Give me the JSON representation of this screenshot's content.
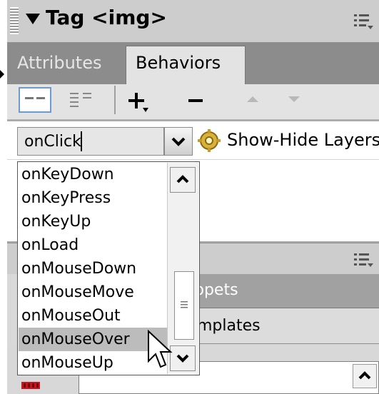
{
  "panel": {
    "title": "Tag <img>",
    "tabs": [
      {
        "label": "Attributes",
        "active": false
      },
      {
        "label": "Behaviors",
        "active": true
      }
    ]
  },
  "toolbar": {
    "show_set_events_icon": "list-view-icon",
    "show_all_events_icon": "list-all-icon",
    "add_icon": "plus-icon",
    "remove_icon": "minus-icon",
    "move_up_icon": "up-arrow-icon",
    "move_down_icon": "down-arrow-icon"
  },
  "behavior_row": {
    "event_value": "onClick",
    "action_icon": "gear-icon",
    "action_label": "Show-Hide Layers"
  },
  "event_dropdown": {
    "items": [
      "onKeyDown",
      "onKeyPress",
      "onKeyUp",
      "onLoad",
      "onMouseDown",
      "onMouseMove",
      "onMouseOut",
      "onMouseOver",
      "onMouseUp"
    ],
    "highlighted": "onMouseOver"
  },
  "lower_panel": {
    "snippets_label": "ppets",
    "templates_label": "mplates"
  },
  "colors": {
    "panel_gray": "#a9a9a9",
    "tab_strip": "#8c8c8c",
    "highlight": "#bcbcbc"
  }
}
